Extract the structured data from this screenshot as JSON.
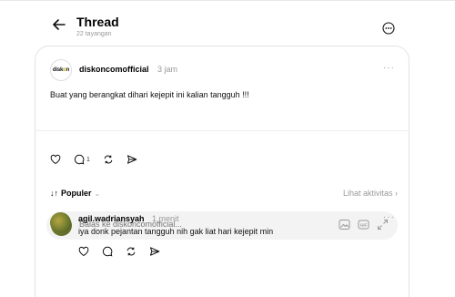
{
  "header": {
    "title": "Thread",
    "subtitle": "22 tayangan"
  },
  "post": {
    "avatar_text_a": "disk",
    "avatar_text_o": "o",
    "avatar_text_b": "n",
    "username": "diskoncomofficial",
    "time": "3 jam",
    "more": "···",
    "text": "Buat yang berangkat dihari kejepit ini kalian tangguh !!!",
    "reply_count": "1"
  },
  "sort": {
    "icon": "↓↑",
    "label": "Populer",
    "chevron": "⌄",
    "activity": "Lihat aktivitas ›"
  },
  "reply": {
    "placeholder": "Balas ke diskoncomofficial..."
  },
  "comment": {
    "username": "agil.wadriansyah",
    "time": "1 menit",
    "more": "···",
    "text": "iya donk pejantan tangguh nih gak liat hari kejepit min"
  },
  "colors": {
    "muted": "#999999",
    "border": "#e3e3e3",
    "reply_bg": "#f3f3f3",
    "logo_accent": "#b9a400"
  }
}
